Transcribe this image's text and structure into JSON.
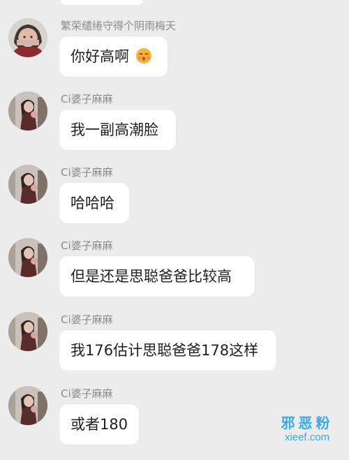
{
  "messages": [
    {
      "sender": "繁荣缱绻守得个阴雨梅天",
      "text": "你好高啊",
      "emoji": "kiss-emoji",
      "avatar": "avatar-user-1"
    },
    {
      "sender": "Ci婆子麻麻",
      "text": "我一副高潮脸",
      "avatar": "avatar-user-2"
    },
    {
      "sender": "Ci婆子麻麻",
      "text": "哈哈哈",
      "avatar": "avatar-user-2"
    },
    {
      "sender": "Ci婆子麻麻",
      "text": "但是还是思聪爸爸比较高",
      "avatar": "avatar-user-2"
    },
    {
      "sender": "Ci婆子麻麻",
      "text": "我176估计思聪爸爸178这样",
      "avatar": "avatar-user-2"
    },
    {
      "sender": "Ci婆子麻麻",
      "text": "或者180",
      "avatar": "avatar-user-2"
    }
  ],
  "watermark": {
    "chinese": "邪恶粉",
    "url": "xieef.com"
  },
  "colors": {
    "background": "#ececec",
    "bubble": "#ffffff",
    "sender_text": "#8a8a8a",
    "message_text": "#1f1f1f",
    "watermark": "#38a8e8"
  }
}
